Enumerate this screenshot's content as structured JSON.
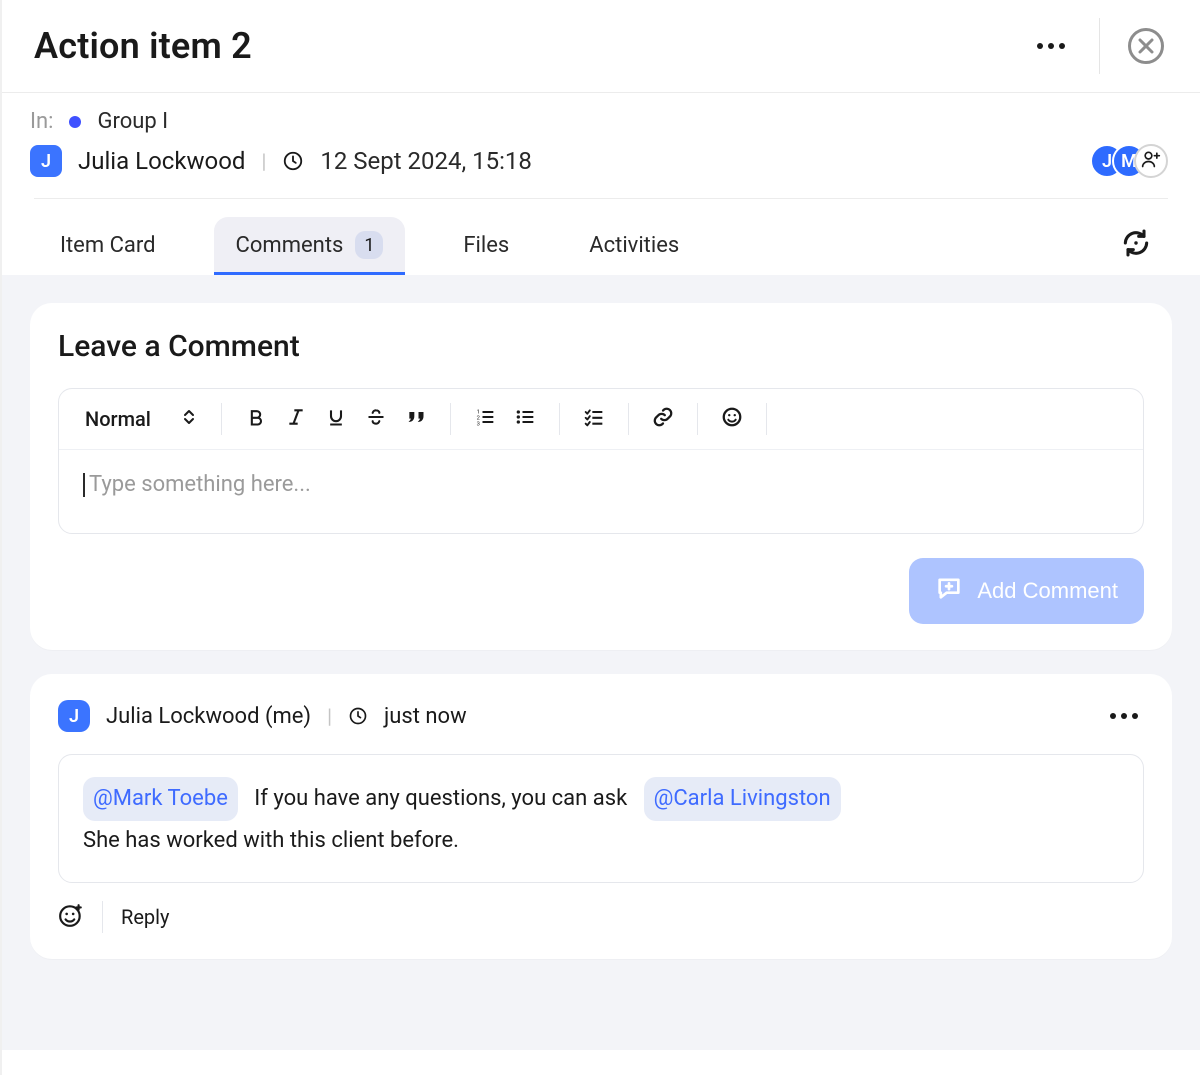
{
  "header": {
    "title": "Action item 2"
  },
  "meta": {
    "in_label": "In:",
    "group_name": "Group I",
    "author_name": "Julia Lockwood",
    "author_initial": "J",
    "timestamp": "12 Sept 2024, 15:18",
    "assignees": [
      {
        "initial": "J"
      },
      {
        "initial": "M"
      }
    ]
  },
  "tabs": {
    "item_card": "Item Card",
    "comments": "Comments",
    "comments_count": "1",
    "files": "Files",
    "activities": "Activities",
    "active": "comments"
  },
  "compose": {
    "title": "Leave a Comment",
    "format_label": "Normal",
    "placeholder": "Type something here...",
    "submit_label": "Add Comment"
  },
  "comments_list": [
    {
      "author_initial": "J",
      "author_display": "Julia Lockwood (me)",
      "time": "just now",
      "mention1": "@Mark Toebe",
      "body_mid": "If you have any questions, you can ask",
      "mention2": "@Carla Livingston",
      "body_line2": "She has worked with this client before.",
      "reply_label": "Reply"
    }
  ]
}
